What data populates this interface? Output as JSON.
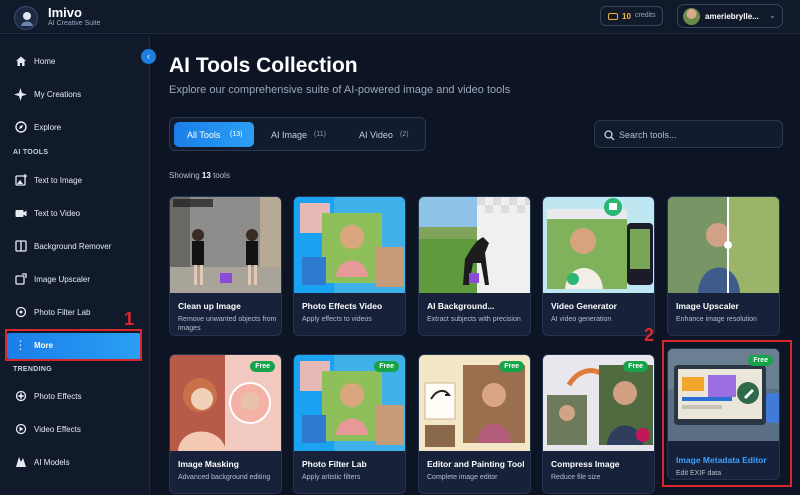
{
  "app": {
    "name": "Imivo",
    "subtitle": "AI Creative Suite"
  },
  "header": {
    "credits_count": "10",
    "credits_label": "credits",
    "username": "ameriebrylle..."
  },
  "sidebar": {
    "items": [
      {
        "label": "Home",
        "icon": "home-icon"
      },
      {
        "label": "My Creations",
        "icon": "sparkle-icon"
      },
      {
        "label": "Explore",
        "icon": "compass-icon"
      }
    ],
    "section_ai_tools": "AI TOOLS",
    "ai_tools": [
      {
        "label": "Text to Image",
        "icon": "image-plus-icon"
      },
      {
        "label": "Text to Video",
        "icon": "video-icon"
      },
      {
        "label": "Background Remover",
        "icon": "split-icon"
      },
      {
        "label": "Image Upscaler",
        "icon": "upscale-icon"
      },
      {
        "label": "Photo Filter Lab",
        "icon": "filter-icon"
      },
      {
        "label": "More",
        "icon": "more-vertical-icon"
      }
    ],
    "section_trending": "TRENDING",
    "trending": [
      {
        "label": "Photo Effects",
        "icon": "effects-icon"
      },
      {
        "label": "Video Effects",
        "icon": "video-effects-icon"
      },
      {
        "label": "AI Models",
        "icon": "models-icon"
      }
    ]
  },
  "main": {
    "title": "AI Tools Collection",
    "description": "Explore our comprehensive suite of AI-powered image and video tools",
    "tabs": [
      {
        "label": "All Tools",
        "count": "(13)"
      },
      {
        "label": "AI Image",
        "count": "(11)"
      },
      {
        "label": "AI Video",
        "count": "(2)"
      }
    ],
    "search_placeholder": "Search tools...",
    "showing_prefix": "Showing",
    "showing_count": "13",
    "showing_suffix": "tools",
    "free_badge": "Free",
    "cards": [
      {
        "name": "Clean up Image",
        "desc": "Remove unwanted objects from images"
      },
      {
        "name": "Photo Effects Video",
        "desc": "Apply effects to videos"
      },
      {
        "name": "AI Background...",
        "desc": "Extract subjects with precision"
      },
      {
        "name": "Video Generator",
        "desc": "AI video generation"
      },
      {
        "name": "Image Upscaler",
        "desc": "Enhance image resolution"
      },
      {
        "name": "Image Masking",
        "desc": "Advanced background editing"
      },
      {
        "name": "Photo Filter Lab",
        "desc": "Apply artistic filters"
      },
      {
        "name": "Editor and Painting Tool",
        "desc": "Complete image editor"
      },
      {
        "name": "Compress Image",
        "desc": "Reduce file size"
      },
      {
        "name": "Image Metadata Editor",
        "desc": "Edit EXIF data"
      }
    ]
  },
  "annotations": {
    "label_1": "1",
    "label_2": "2"
  },
  "colors": {
    "accent": "#1a7ee8",
    "highlight_red": "#d8262c",
    "free_green": "#16a34a",
    "credits_gold": "#f5b93b"
  }
}
